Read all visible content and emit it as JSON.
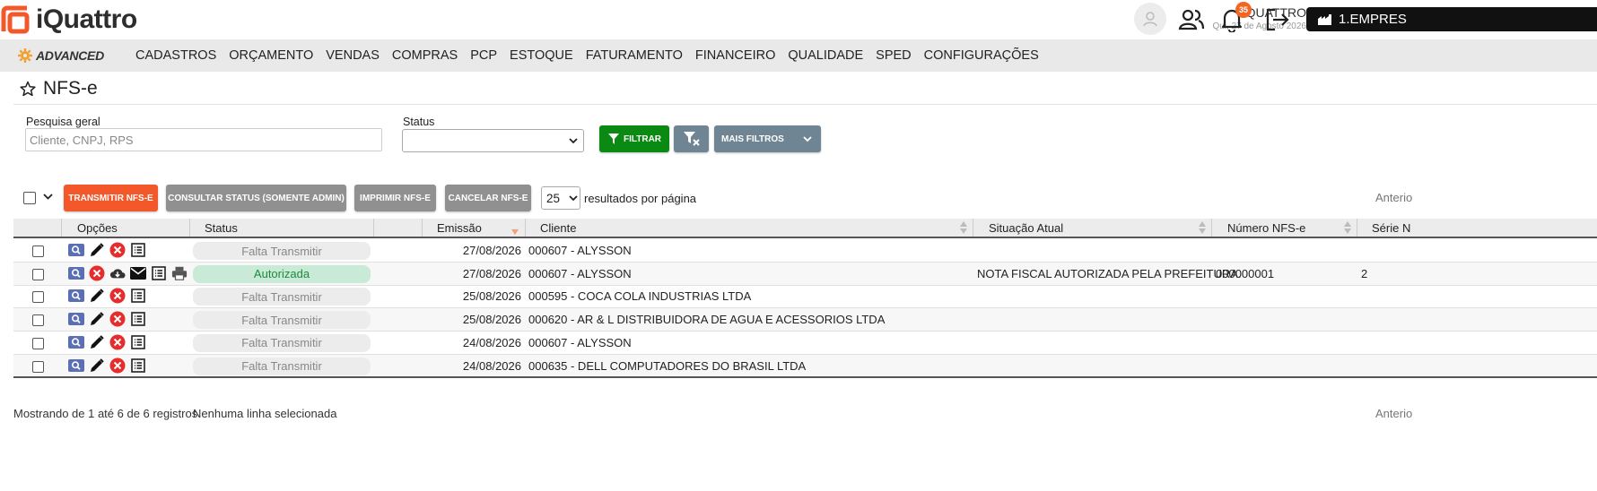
{
  "header": {
    "logo_text": "iQuattro",
    "user_name": "IQUATTRO",
    "date": "Qui, 27 de Agosto 2026",
    "notifications_count": "35",
    "empresa_label": "1.EMPRES"
  },
  "nav": {
    "brand": "ADVANCED",
    "items": [
      "CADASTROS",
      "ORÇAMENTO",
      "VENDAS",
      "COMPRAS",
      "PCP",
      "ESTOQUE",
      "FATURAMENTO",
      "FINANCEIRO",
      "QUALIDADE",
      "SPED",
      "CONFIGURAÇÕES"
    ]
  },
  "page": {
    "title": "NFS-e"
  },
  "filters": {
    "search_label": "Pesquisa geral",
    "search_placeholder": "Cliente, CNPJ, RPS",
    "search_value": "",
    "status_label": "Status",
    "status_value": "",
    "filter_button": "FILTRAR",
    "more_filters_button": "MAIS FILTROS"
  },
  "toolbar": {
    "transmit": "TRANSMITIR NFS-E",
    "consult": "CONSULTAR STATUS (SOMENTE ADMIN)",
    "print": "IMPRIMIR NFS-E",
    "cancel": "CANCELAR NFS-E",
    "per_page": "25",
    "per_page_label": "resultados por página",
    "prev_label": "Anterio"
  },
  "table": {
    "columns": [
      "Opções",
      "Status",
      "Emissão",
      "Cliente",
      "Situação Atual",
      "Número NFS-e",
      "Série N"
    ],
    "rows": [
      {
        "status": "Falta Transmitir",
        "authorized": false,
        "emissao": "27/08/2026",
        "cliente": "000607 - ALYSSON",
        "situacao": "",
        "numero": "",
        "serie": ""
      },
      {
        "status": "Autorizada",
        "authorized": true,
        "emissao": "27/08/2026",
        "cliente": "000607 - ALYSSON",
        "situacao": "NOTA FISCAL AUTORIZADA PELA PREFEITURA.",
        "numero": "000000001",
        "serie": "2"
      },
      {
        "status": "Falta Transmitir",
        "authorized": false,
        "emissao": "25/08/2026",
        "cliente": "000595 - COCA COLA INDUSTRIAS LTDA",
        "situacao": "",
        "numero": "",
        "serie": ""
      },
      {
        "status": "Falta Transmitir",
        "authorized": false,
        "emissao": "25/08/2026",
        "cliente": "000620 - AR & L DISTRIBUIDORA DE AGUA E ACESSORIOS LTDA",
        "situacao": "",
        "numero": "",
        "serie": ""
      },
      {
        "status": "Falta Transmitir",
        "authorized": false,
        "emissao": "24/08/2026",
        "cliente": "000607 - ALYSSON",
        "situacao": "",
        "numero": "",
        "serie": ""
      },
      {
        "status": "Falta Transmitir",
        "authorized": false,
        "emissao": "24/08/2026",
        "cliente": "000635 - DELL COMPUTADORES DO BRASIL LTDA",
        "situacao": "",
        "numero": "",
        "serie": ""
      }
    ]
  },
  "footer": {
    "showing": "Mostrando de 1 até 6 de 6 registros",
    "selection": "Nenhuma linha selecionada",
    "prev_label": "Anterio"
  },
  "colors": {
    "accent_orange": "#f2582a",
    "green": "#0a8a12",
    "slate": "#6f8593",
    "authorized_bg": "#c8ead7"
  }
}
